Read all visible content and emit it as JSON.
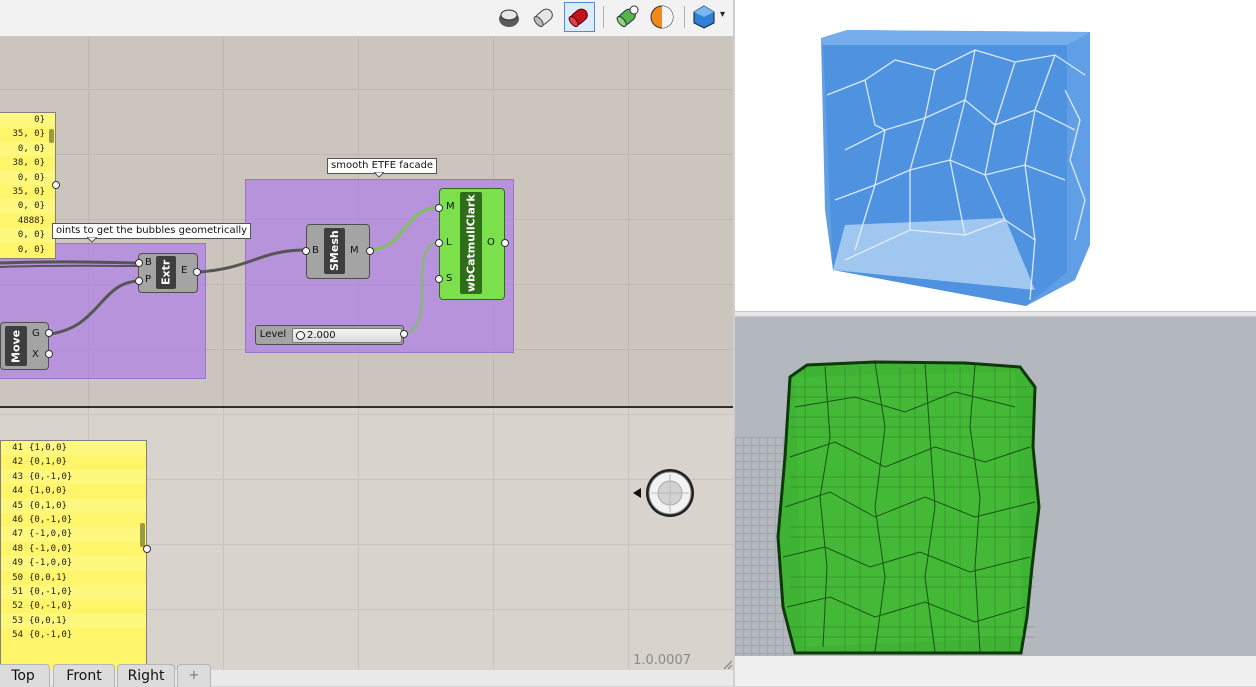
{
  "toolbar": {
    "icons": [
      "preview-wireframe-icon",
      "preview-shaded-icon",
      "preview-selected-icon",
      "bake-icon",
      "material-icon",
      "display-mode-icon"
    ],
    "dropdown_glyph": "▾"
  },
  "canvas": {
    "upper_panel": {
      "rows": [
        "0}",
        "35, 0}",
        "0, 0}",
        "38, 0}",
        "0, 0}",
        "35, 0}",
        "0, 0}",
        "4888}",
        "0, 0}",
        "0, 0}"
      ]
    },
    "group_left": {
      "tooltip": "oints to get the bubbles geometrically",
      "extr": {
        "name": "Extr",
        "in1": "B",
        "in2": "P",
        "out": "E"
      },
      "move": {
        "name": "Move",
        "out1": "G",
        "out2": "X"
      }
    },
    "group_right": {
      "tooltip": "smooth ETFE facade",
      "smesh": {
        "name": "SMesh",
        "in": "B",
        "out": "M"
      },
      "wb": {
        "name": "wbCatmullClark",
        "in1": "M",
        "in2": "L",
        "in3": "S",
        "out": "O"
      },
      "slider": {
        "label": "Level",
        "value": "2.000"
      }
    },
    "lower_panel": {
      "rows": [
        {
          "i": "41",
          "v": "{1,0,0}"
        },
        {
          "i": "42",
          "v": "{0,1,0}"
        },
        {
          "i": "43",
          "v": "{0,-1,0}"
        },
        {
          "i": "44",
          "v": "{1,0,0}"
        },
        {
          "i": "45",
          "v": "{0,1,0}"
        },
        {
          "i": "46",
          "v": "{0,-1,0}"
        },
        {
          "i": "47",
          "v": "{-1,0,0}"
        },
        {
          "i": "48",
          "v": "{-1,0,0}"
        },
        {
          "i": "49",
          "v": "{-1,0,0}"
        },
        {
          "i": "50",
          "v": "{0,0,1}"
        },
        {
          "i": "51",
          "v": "{0,-1,0}"
        },
        {
          "i": "52",
          "v": "{0,-1,0}"
        },
        {
          "i": "53",
          "v": "{0,0,1}"
        },
        {
          "i": "54",
          "v": "{0,-1,0}"
        }
      ]
    },
    "version": "1.0.0007"
  },
  "view_tabs": [
    "Top",
    "Front",
    "Right"
  ],
  "add_tab_glyph": "+",
  "colors": {
    "group_purple": "#ad80e6",
    "panel_yellow": "#fff56a",
    "wb_green": "#7be04c",
    "mesh_blue": "#4a90e2",
    "mesh_green": "#3cb030"
  }
}
